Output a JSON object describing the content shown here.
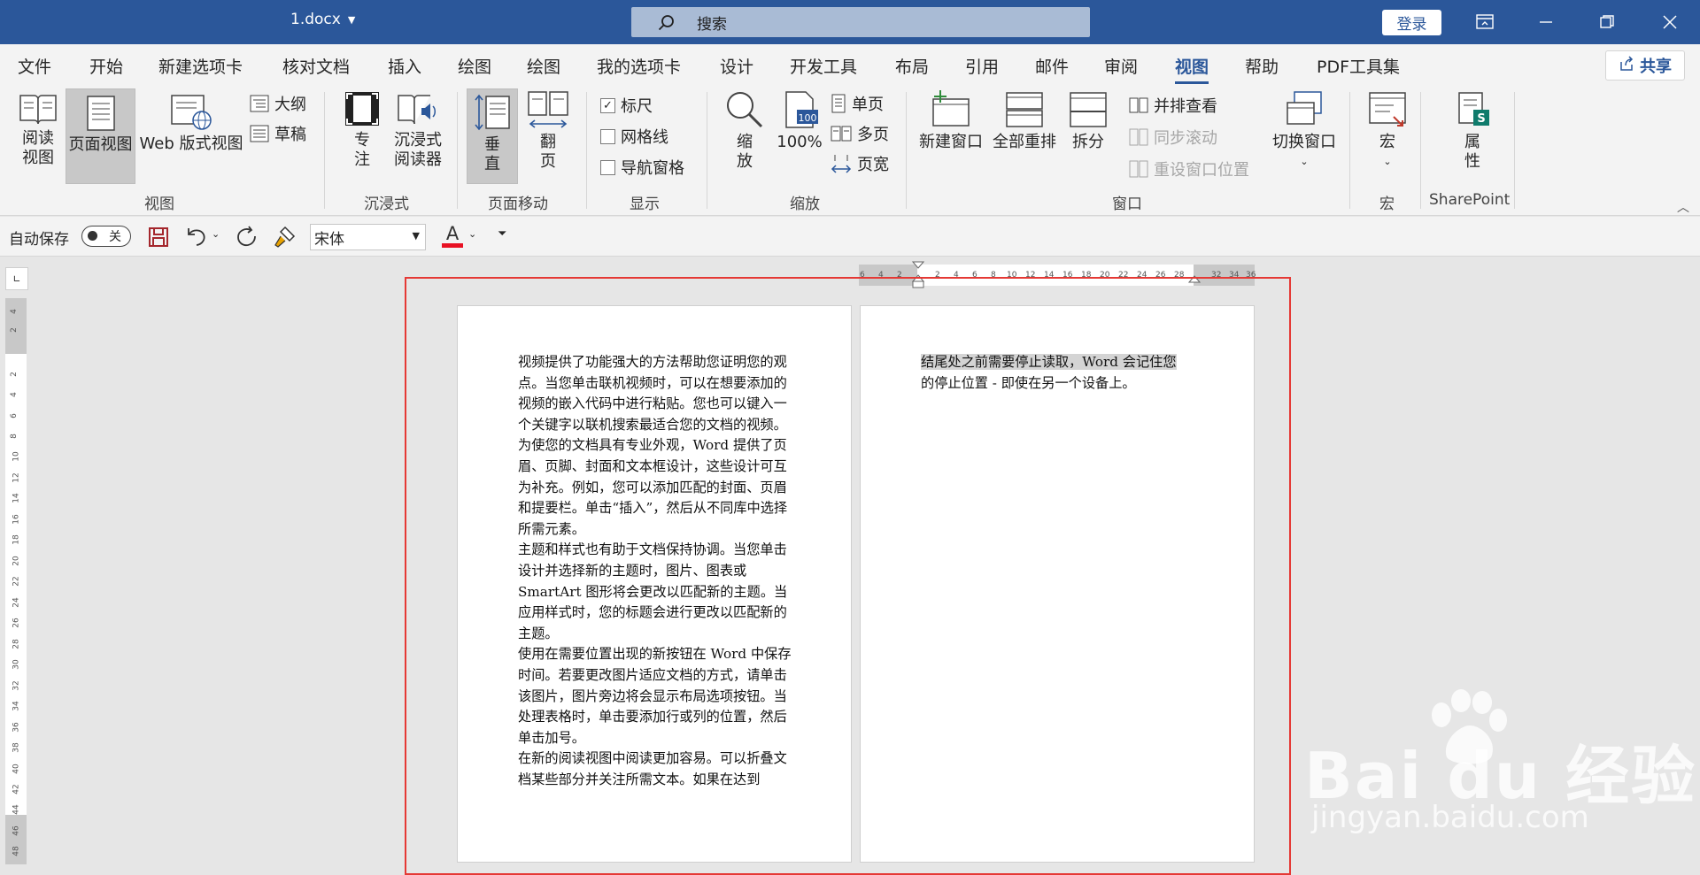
{
  "titlebar": {
    "filename": "1.docx",
    "search_label": "搜索",
    "login_label": "登录"
  },
  "menu": {
    "tabs": [
      "文件",
      "开始",
      "新建选项卡",
      "核对文档",
      "插入",
      "绘图",
      "绘图",
      "我的选项卡",
      "设计",
      "开发工具",
      "布局",
      "引用",
      "邮件",
      "审阅",
      "视图",
      "帮助",
      "PDF工具集"
    ],
    "active_tab": "视图",
    "share_label": "共享"
  },
  "ribbon": {
    "views": {
      "label": "视图",
      "read": "阅读\n视图",
      "print": "页面视图",
      "web": "Web 版式视图",
      "outline": "大纲",
      "draft": "草稿"
    },
    "immersive": {
      "label": "沉浸式",
      "focus": "专\n注",
      "reader": "沉浸式\n阅读器"
    },
    "page_movement": {
      "label": "页面移动",
      "vertical": "垂\n直",
      "side": "翻\n页"
    },
    "show": {
      "label": "显示",
      "ruler": "标尺",
      "gridlines": "网格线",
      "navpane": "导航窗格"
    },
    "zoom": {
      "label": "缩放",
      "zoom": "缩\n放",
      "hundred": "100%",
      "one_page": "单页",
      "multi_page": "多页",
      "page_width": "页宽"
    },
    "window": {
      "label": "窗口",
      "new_window": "新建窗口",
      "arrange_all": "全部重排",
      "split": "拆分",
      "side_by_side": "并排查看",
      "sync_scroll": "同步滚动",
      "reset_pos": "重设窗口位置",
      "switch": "切换窗口"
    },
    "macros": {
      "label": "宏",
      "macros": "宏"
    },
    "sharepoint": {
      "label": "SharePoint",
      "properties": "属\n性"
    }
  },
  "qat": {
    "autosave": "自动保存",
    "toggle_state": "关",
    "font": "宋体"
  },
  "rulers": {
    "h_ticks": [
      "6",
      "4",
      "2",
      "2",
      "4",
      "6",
      "8",
      "10",
      "12",
      "14",
      "16",
      "18",
      "20",
      "22",
      "24",
      "26",
      "28",
      "32",
      "34",
      "36"
    ],
    "v_ticks": [
      "4",
      "2",
      "2",
      "4",
      "6",
      "8",
      "10",
      "12",
      "14",
      "16",
      "18",
      "20",
      "22",
      "24",
      "26",
      "28",
      "30",
      "32",
      "34",
      "36",
      "38",
      "40",
      "42",
      "44",
      "46",
      "48"
    ]
  },
  "page1": {
    "paragraphs": [
      "视频提供了功能强大的方法帮助您证明您的观点。当您单击联机视频时，可以在想要添加的视频的嵌入代码中进行粘贴。您也可以键入一个关键字以联机搜索最适合您的文档的视频。",
      "为使您的文档具有专业外观，Word 提供了页眉、页脚、封面和文本框设计，这些设计可互为补充。例如，您可以添加匹配的封面、页眉和提要栏。单击“插入”，然后从不同库中选择所需元素。",
      "主题和样式也有助于文档保持协调。当您单击设计并选择新的主题时，图片、图表或 SmartArt 图形将会更改以匹配新的主题。当应用样式时，您的标题会进行更改以匹配新的主题。",
      "使用在需要位置出现的新按钮在 Word 中保存时间。若要更改图片适应文档的方式，请单击该图片，图片旁边将会显示布局选项按钮。当处理表格时，单击要添加行或列的位置，然后单击加号。",
      "在新的阅读视图中阅读更加容易。可以折叠文档某些部分并关注所需文本。如果在达到"
    ]
  },
  "page2": {
    "line1": "结尾处之前需要停止读取，Word 会记住您",
    "line2": "的停止位置 - 即使在另一个设备上。"
  },
  "watermark": {
    "big": "Bai du 经验",
    "small": "jingyan.baidu.com"
  }
}
